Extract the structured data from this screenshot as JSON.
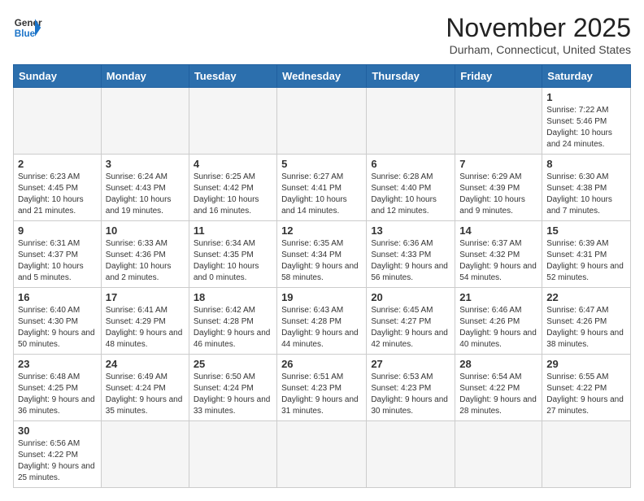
{
  "header": {
    "logo_general": "General",
    "logo_blue": "Blue",
    "month_title": "November 2025",
    "location": "Durham, Connecticut, United States"
  },
  "days_of_week": [
    "Sunday",
    "Monday",
    "Tuesday",
    "Wednesday",
    "Thursday",
    "Friday",
    "Saturday"
  ],
  "weeks": [
    [
      {
        "day": "",
        "info": "",
        "empty": true
      },
      {
        "day": "",
        "info": "",
        "empty": true
      },
      {
        "day": "",
        "info": "",
        "empty": true
      },
      {
        "day": "",
        "info": "",
        "empty": true
      },
      {
        "day": "",
        "info": "",
        "empty": true
      },
      {
        "day": "",
        "info": "",
        "empty": true
      },
      {
        "day": "1",
        "info": "Sunrise: 7:22 AM\nSunset: 5:46 PM\nDaylight: 10 hours and 24 minutes."
      }
    ],
    [
      {
        "day": "2",
        "info": "Sunrise: 6:23 AM\nSunset: 4:45 PM\nDaylight: 10 hours and 21 minutes."
      },
      {
        "day": "3",
        "info": "Sunrise: 6:24 AM\nSunset: 4:43 PM\nDaylight: 10 hours and 19 minutes."
      },
      {
        "day": "4",
        "info": "Sunrise: 6:25 AM\nSunset: 4:42 PM\nDaylight: 10 hours and 16 minutes."
      },
      {
        "day": "5",
        "info": "Sunrise: 6:27 AM\nSunset: 4:41 PM\nDaylight: 10 hours and 14 minutes."
      },
      {
        "day": "6",
        "info": "Sunrise: 6:28 AM\nSunset: 4:40 PM\nDaylight: 10 hours and 12 minutes."
      },
      {
        "day": "7",
        "info": "Sunrise: 6:29 AM\nSunset: 4:39 PM\nDaylight: 10 hours and 9 minutes."
      },
      {
        "day": "8",
        "info": "Sunrise: 6:30 AM\nSunset: 4:38 PM\nDaylight: 10 hours and 7 minutes."
      }
    ],
    [
      {
        "day": "9",
        "info": "Sunrise: 6:31 AM\nSunset: 4:37 PM\nDaylight: 10 hours and 5 minutes."
      },
      {
        "day": "10",
        "info": "Sunrise: 6:33 AM\nSunset: 4:36 PM\nDaylight: 10 hours and 2 minutes."
      },
      {
        "day": "11",
        "info": "Sunrise: 6:34 AM\nSunset: 4:35 PM\nDaylight: 10 hours and 0 minutes."
      },
      {
        "day": "12",
        "info": "Sunrise: 6:35 AM\nSunset: 4:34 PM\nDaylight: 9 hours and 58 minutes."
      },
      {
        "day": "13",
        "info": "Sunrise: 6:36 AM\nSunset: 4:33 PM\nDaylight: 9 hours and 56 minutes."
      },
      {
        "day": "14",
        "info": "Sunrise: 6:37 AM\nSunset: 4:32 PM\nDaylight: 9 hours and 54 minutes."
      },
      {
        "day": "15",
        "info": "Sunrise: 6:39 AM\nSunset: 4:31 PM\nDaylight: 9 hours and 52 minutes."
      }
    ],
    [
      {
        "day": "16",
        "info": "Sunrise: 6:40 AM\nSunset: 4:30 PM\nDaylight: 9 hours and 50 minutes."
      },
      {
        "day": "17",
        "info": "Sunrise: 6:41 AM\nSunset: 4:29 PM\nDaylight: 9 hours and 48 minutes."
      },
      {
        "day": "18",
        "info": "Sunrise: 6:42 AM\nSunset: 4:28 PM\nDaylight: 9 hours and 46 minutes."
      },
      {
        "day": "19",
        "info": "Sunrise: 6:43 AM\nSunset: 4:28 PM\nDaylight: 9 hours and 44 minutes."
      },
      {
        "day": "20",
        "info": "Sunrise: 6:45 AM\nSunset: 4:27 PM\nDaylight: 9 hours and 42 minutes."
      },
      {
        "day": "21",
        "info": "Sunrise: 6:46 AM\nSunset: 4:26 PM\nDaylight: 9 hours and 40 minutes."
      },
      {
        "day": "22",
        "info": "Sunrise: 6:47 AM\nSunset: 4:26 PM\nDaylight: 9 hours and 38 minutes."
      }
    ],
    [
      {
        "day": "23",
        "info": "Sunrise: 6:48 AM\nSunset: 4:25 PM\nDaylight: 9 hours and 36 minutes."
      },
      {
        "day": "24",
        "info": "Sunrise: 6:49 AM\nSunset: 4:24 PM\nDaylight: 9 hours and 35 minutes."
      },
      {
        "day": "25",
        "info": "Sunrise: 6:50 AM\nSunset: 4:24 PM\nDaylight: 9 hours and 33 minutes."
      },
      {
        "day": "26",
        "info": "Sunrise: 6:51 AM\nSunset: 4:23 PM\nDaylight: 9 hours and 31 minutes."
      },
      {
        "day": "27",
        "info": "Sunrise: 6:53 AM\nSunset: 4:23 PM\nDaylight: 9 hours and 30 minutes."
      },
      {
        "day": "28",
        "info": "Sunrise: 6:54 AM\nSunset: 4:22 PM\nDaylight: 9 hours and 28 minutes."
      },
      {
        "day": "29",
        "info": "Sunrise: 6:55 AM\nSunset: 4:22 PM\nDaylight: 9 hours and 27 minutes."
      }
    ],
    [
      {
        "day": "30",
        "info": "Sunrise: 6:56 AM\nSunset: 4:22 PM\nDaylight: 9 hours and 25 minutes."
      },
      {
        "day": "",
        "info": "",
        "empty": true
      },
      {
        "day": "",
        "info": "",
        "empty": true
      },
      {
        "day": "",
        "info": "",
        "empty": true
      },
      {
        "day": "",
        "info": "",
        "empty": true
      },
      {
        "day": "",
        "info": "",
        "empty": true
      },
      {
        "day": "",
        "info": "",
        "empty": true
      }
    ]
  ]
}
